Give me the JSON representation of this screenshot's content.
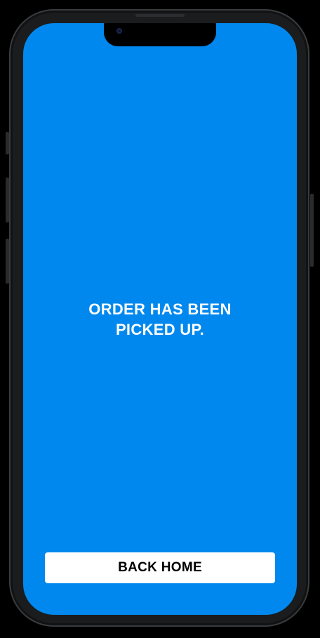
{
  "screen": {
    "background_color": "#0088ee",
    "message_lines": [
      "ORDER HAS BEEN",
      "PICKED UP."
    ]
  },
  "actions": {
    "back_home_label": "BACK HOME",
    "back_home_bg": "#ffffff"
  }
}
